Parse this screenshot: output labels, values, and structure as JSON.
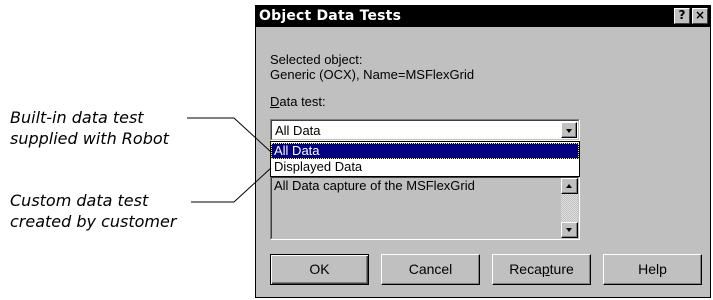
{
  "callouts": {
    "builtin_line1": "Built-in data test",
    "builtin_line2": "supplied with Robot",
    "custom_line1": "Custom data test",
    "custom_line2": "created by customer"
  },
  "dialog": {
    "title": "Object Data Tests",
    "help_glyph": "?",
    "close_glyph": "×",
    "selected_object_label": "Selected object:",
    "selected_object_value": "Generic (OCX), Name=MSFlexGrid",
    "data_test_label_hotkey": "D",
    "data_test_label_rest": "ata test:",
    "data_test_selected": "All Data",
    "description_text": "All Data capture of the MSFlexGrid",
    "dropdown_options": [
      "All Data",
      "Displayed Data"
    ],
    "buttons": {
      "ok": "OK",
      "cancel": "Cancel",
      "recapture_pre": "Reca",
      "recapture_hotkey": "p",
      "recapture_post": "ture",
      "help": "Help"
    }
  },
  "colors": {
    "dialog_face": "#c0c0c0",
    "titlebar": "#000000",
    "selection": "#000080"
  }
}
